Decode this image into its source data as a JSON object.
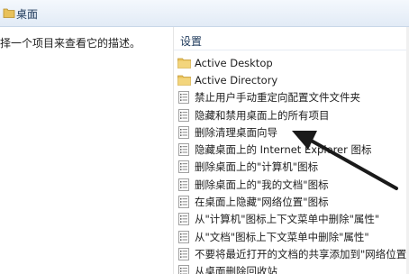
{
  "header": {
    "title": "桌面"
  },
  "description": "择一个项目来查看它的描述。",
  "settings": {
    "header": "设置",
    "items": [
      {
        "label": "Active Desktop",
        "icon": "folder-icon"
      },
      {
        "label": "Active Directory",
        "icon": "folder-icon"
      },
      {
        "label": "禁止用户手动重定向配置文件文件夹",
        "icon": "policy-setting-icon"
      },
      {
        "label": "隐藏和禁用桌面上的所有项目",
        "icon": "policy-setting-icon"
      },
      {
        "label": "删除清理桌面向导",
        "icon": "policy-setting-icon"
      },
      {
        "label": "隐藏桌面上的 Internet Explorer 图标",
        "icon": "policy-setting-icon"
      },
      {
        "label": "删除桌面上的\"计算机\"图标",
        "icon": "policy-setting-icon"
      },
      {
        "label": "删除桌面上的\"我的文档\"图标",
        "icon": "policy-setting-icon"
      },
      {
        "label": "在桌面上隐藏\"网络位置\"图标",
        "icon": "policy-setting-icon"
      },
      {
        "label": "从\"计算机\"图标上下文菜单中删除\"属性\"",
        "icon": "policy-setting-icon"
      },
      {
        "label": "从\"文档\"图标上下文菜单中删除\"属性\"",
        "icon": "policy-setting-icon"
      },
      {
        "label": "不要将最近打开的文档的共享添加到\"网络位置\"",
        "icon": "policy-setting-icon"
      },
      {
        "label": "从桌面删除回收站",
        "icon": "policy-setting-icon"
      }
    ]
  },
  "colors": {
    "folder": "#e8c15a",
    "arrow": "#1a1a1a",
    "header_text": "#1e395b"
  }
}
